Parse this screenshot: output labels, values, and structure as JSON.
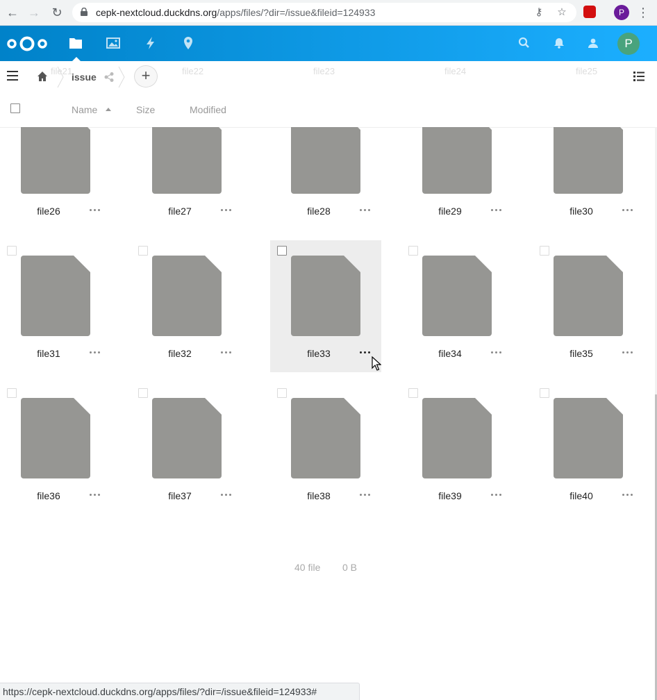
{
  "browser": {
    "url_host": "cepk-nextcloud.duckdns.org",
    "url_path": "/apps/files/?dir=/issue&fileid=124933",
    "profile_initial": "P",
    "status_url": "https://cepk-nextcloud.duckdns.org/apps/files/?dir=/issue&fileid=124933#"
  },
  "header": {
    "avatar_initial": "P",
    "apps": [
      {
        "name": "files-icon",
        "active": true
      },
      {
        "name": "photos-icon"
      },
      {
        "name": "activity-icon"
      },
      {
        "name": "maps-icon"
      }
    ],
    "brand_color": "#0082c9"
  },
  "controls": {
    "breadcrumb": "issue",
    "ghost_rows": [
      "file21",
      "file22",
      "file23",
      "file24",
      "file25"
    ]
  },
  "list_header": {
    "name": "Name",
    "size": "Size",
    "modified": "Modified"
  },
  "files": [
    {
      "name": "file26"
    },
    {
      "name": "file27"
    },
    {
      "name": "file28"
    },
    {
      "name": "file29"
    },
    {
      "name": "file30"
    },
    {
      "name": "file31"
    },
    {
      "name": "file32"
    },
    {
      "name": "file33",
      "hovered": true
    },
    {
      "name": "file34"
    },
    {
      "name": "file35"
    },
    {
      "name": "file36"
    },
    {
      "name": "file37"
    },
    {
      "name": "file38"
    },
    {
      "name": "file39"
    },
    {
      "name": "file40"
    }
  ],
  "summary": {
    "count": "40 file",
    "size": "0 B"
  }
}
